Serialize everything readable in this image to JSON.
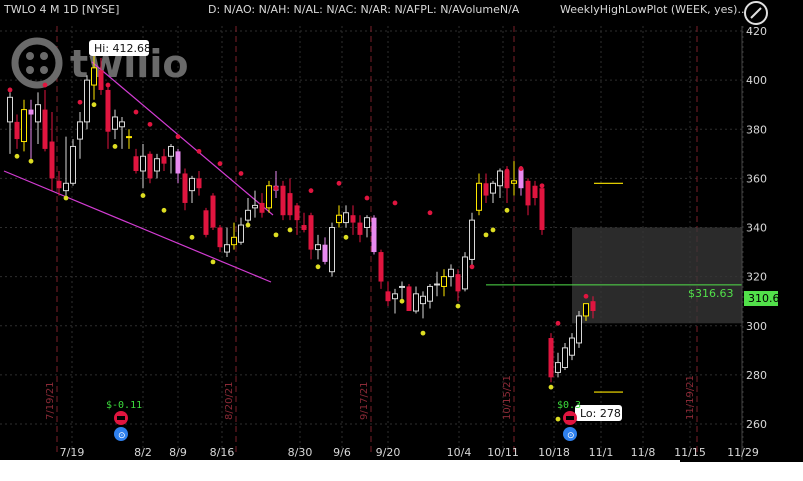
{
  "header": {
    "symbol": "TWLO 4 M 1D [NYSE]",
    "stats": "D: N/AO: N/AH: N/AL: N/AC: N/AR: N/AFPL: N/AVolumeN/A",
    "study": "WeeklyHighLowPlot (WEEK, yes)..."
  },
  "logo": {
    "text": "twilio",
    "color": "#ffffff"
  },
  "colors": {
    "background": "#000000",
    "grid": "#2e2e2e",
    "up": "#d8d8d8",
    "up_alt": "#ffe800",
    "down": "#e0153f",
    "down_alt": "#e88af0",
    "trendline": "#d23cd2",
    "hline": "#52e04a",
    "dot_high": "#e0153f",
    "dot_low": "#dddd22",
    "event_icon_red": "#e0153f",
    "event_icon_blue": "#2f80ed"
  },
  "annotations": {
    "hi_label": "Hi: 412.68",
    "lo_label": "Lo: 278",
    "hline_price_label": "$316.63",
    "last_price_label": "310.6",
    "earnings_left": "$-0.11",
    "earnings_right": "$0.3"
  },
  "vertical_date_labels": [
    "7/19/21",
    "8/20/21",
    "9/17/21",
    "10/15/21",
    "11/19/21"
  ],
  "chart_data": {
    "type": "candlestick",
    "title": "TWLO 4 M 1D [NYSE]",
    "y_ticks": [
      260,
      280,
      300,
      320,
      340,
      360,
      380,
      400,
      420
    ],
    "ylim": [
      250,
      426
    ],
    "x_ticks": [
      "7/19",
      "8/2",
      "8/9",
      "8/16",
      "8/30",
      "9/6",
      "9/20",
      "10/4",
      "10/11",
      "10/18",
      "11/1",
      "11/8",
      "11/15",
      "11/29"
    ],
    "last_price": 310.6,
    "horizontal_level": 316.63,
    "weekly_high_segment": 358,
    "weekly_low_segment": 273,
    "shaded_zone": [
      301,
      340
    ],
    "candles": [
      {
        "o": 383,
        "h": 395,
        "l": 370,
        "c": 393
      },
      {
        "o": 383,
        "h": 386,
        "l": 372,
        "c": 376
      },
      {
        "o": 375,
        "h": 392,
        "l": 371,
        "c": 388
      },
      {
        "o": 388,
        "h": 392,
        "l": 368,
        "c": 386
      },
      {
        "o": 383,
        "h": 395,
        "l": 374,
        "c": 390
      },
      {
        "o": 388,
        "h": 396,
        "l": 371,
        "c": 372
      },
      {
        "o": 375,
        "h": 387,
        "l": 355,
        "c": 360
      },
      {
        "o": 359,
        "h": 363,
        "l": 353,
        "c": 356
      },
      {
        "o": 355,
        "h": 377,
        "l": 353,
        "c": 358
      },
      {
        "o": 358,
        "h": 376,
        "l": 357,
        "c": 373
      },
      {
        "o": 376,
        "h": 387,
        "l": 368,
        "c": 383
      },
      {
        "o": 383,
        "h": 402,
        "l": 380,
        "c": 400
      },
      {
        "o": 398,
        "h": 411,
        "l": 392,
        "c": 405
      },
      {
        "o": 404,
        "h": 409,
        "l": 394,
        "c": 396
      },
      {
        "o": 396,
        "h": 398,
        "l": 372,
        "c": 379
      },
      {
        "o": 380,
        "h": 388,
        "l": 376,
        "c": 385
      },
      {
        "o": 381,
        "h": 385,
        "l": 372,
        "c": 383
      },
      {
        "o": 377,
        "h": 380,
        "l": 372,
        "c": 377
      },
      {
        "o": 369,
        "h": 372,
        "l": 362,
        "c": 363
      },
      {
        "o": 363,
        "h": 374,
        "l": 356,
        "c": 369
      },
      {
        "o": 370,
        "h": 371,
        "l": 358,
        "c": 360
      },
      {
        "o": 363,
        "h": 370,
        "l": 360,
        "c": 368
      },
      {
        "o": 369,
        "h": 372,
        "l": 363,
        "c": 366
      },
      {
        "o": 369,
        "h": 374,
        "l": 362,
        "c": 373
      },
      {
        "o": 371,
        "h": 372,
        "l": 358,
        "c": 362
      },
      {
        "o": 362,
        "h": 364,
        "l": 347,
        "c": 350
      },
      {
        "o": 355,
        "h": 361,
        "l": 350,
        "c": 360
      },
      {
        "o": 360,
        "h": 363,
        "l": 353,
        "c": 356
      },
      {
        "o": 347,
        "h": 348,
        "l": 336,
        "c": 337
      },
      {
        "o": 353,
        "h": 354,
        "l": 339,
        "c": 340
      },
      {
        "o": 340,
        "h": 341,
        "l": 330,
        "c": 332
      },
      {
        "o": 330,
        "h": 340,
        "l": 328,
        "c": 333
      },
      {
        "o": 333,
        "h": 342,
        "l": 331,
        "c": 336
      },
      {
        "o": 334,
        "h": 344,
        "l": 333,
        "c": 341
      },
      {
        "o": 343,
        "h": 352,
        "l": 340,
        "c": 347
      },
      {
        "o": 348,
        "h": 355,
        "l": 344,
        "c": 349
      },
      {
        "o": 350,
        "h": 354,
        "l": 344,
        "c": 346
      },
      {
        "o": 348,
        "h": 359,
        "l": 346,
        "c": 357
      },
      {
        "o": 357,
        "h": 363,
        "l": 352,
        "c": 355
      },
      {
        "o": 357,
        "h": 359,
        "l": 343,
        "c": 345
      },
      {
        "o": 354,
        "h": 360,
        "l": 343,
        "c": 345
      },
      {
        "o": 349,
        "h": 350,
        "l": 337,
        "c": 343
      },
      {
        "o": 341,
        "h": 346,
        "l": 338,
        "c": 339
      },
      {
        "o": 345,
        "h": 346,
        "l": 327,
        "c": 331
      },
      {
        "o": 331,
        "h": 337,
        "l": 327,
        "c": 333
      },
      {
        "o": 333,
        "h": 336,
        "l": 325,
        "c": 326
      },
      {
        "o": 322,
        "h": 342,
        "l": 320,
        "c": 340
      },
      {
        "o": 342,
        "h": 349,
        "l": 340,
        "c": 345
      },
      {
        "o": 342,
        "h": 349,
        "l": 340,
        "c": 346
      },
      {
        "o": 345,
        "h": 349,
        "l": 337,
        "c": 342
      },
      {
        "o": 342,
        "h": 345,
        "l": 334,
        "c": 337
      },
      {
        "o": 340,
        "h": 345,
        "l": 336,
        "c": 344
      },
      {
        "o": 344,
        "h": 345,
        "l": 329,
        "c": 330
      },
      {
        "o": 330,
        "h": 331,
        "l": 315,
        "c": 318
      },
      {
        "o": 314,
        "h": 318,
        "l": 308,
        "c": 310
      },
      {
        "o": 311,
        "h": 315,
        "l": 305,
        "c": 313
      },
      {
        "o": 316,
        "h": 318,
        "l": 311,
        "c": 316
      },
      {
        "o": 316,
        "h": 317,
        "l": 306,
        "c": 306
      },
      {
        "o": 306,
        "h": 316,
        "l": 305,
        "c": 313
      },
      {
        "o": 309,
        "h": 314,
        "l": 303,
        "c": 312
      },
      {
        "o": 310,
        "h": 317,
        "l": 307,
        "c": 316
      },
      {
        "o": 317,
        "h": 322,
        "l": 312,
        "c": 317
      },
      {
        "o": 316,
        "h": 323,
        "l": 312,
        "c": 320
      },
      {
        "o": 320,
        "h": 325,
        "l": 316,
        "c": 323
      },
      {
        "o": 321,
        "h": 323,
        "l": 310,
        "c": 314
      },
      {
        "o": 315,
        "h": 330,
        "l": 314,
        "c": 328
      },
      {
        "o": 327,
        "h": 346,
        "l": 324,
        "c": 343
      },
      {
        "o": 347,
        "h": 362,
        "l": 345,
        "c": 358
      },
      {
        "o": 358,
        "h": 362,
        "l": 350,
        "c": 353
      },
      {
        "o": 354,
        "h": 359,
        "l": 350,
        "c": 358
      },
      {
        "o": 357,
        "h": 364,
        "l": 352,
        "c": 363
      },
      {
        "o": 363,
        "h": 365,
        "l": 350,
        "c": 356
      },
      {
        "o": 358,
        "h": 367,
        "l": 353,
        "c": 359
      },
      {
        "o": 364,
        "h": 365,
        "l": 353,
        "c": 356
      },
      {
        "o": 359,
        "h": 360,
        "l": 345,
        "c": 349
      },
      {
        "o": 357,
        "h": 359,
        "l": 349,
        "c": 352
      },
      {
        "o": 356,
        "h": 357,
        "l": 337,
        "c": 339
      },
      {
        "o": 295,
        "h": 297,
        "l": 277,
        "c": 279
      },
      {
        "o": 281,
        "h": 289,
        "l": 279,
        "c": 285
      },
      {
        "o": 283,
        "h": 293,
        "l": 282,
        "c": 291
      },
      {
        "o": 288,
        "h": 297,
        "l": 286,
        "c": 295
      },
      {
        "o": 293,
        "h": 306,
        "l": 291,
        "c": 304
      },
      {
        "o": 304,
        "h": 309,
        "l": 302,
        "c": 309
      },
      {
        "o": 310,
        "h": 312,
        "l": 303,
        "c": 306
      }
    ],
    "high_dots": [
      [
        0,
        396
      ],
      [
        5,
        398
      ],
      [
        10,
        391
      ],
      [
        14,
        398
      ],
      [
        18,
        387
      ],
      [
        20,
        382
      ],
      [
        24,
        377
      ],
      [
        27,
        371
      ],
      [
        30,
        366
      ],
      [
        33,
        362
      ],
      [
        38,
        356
      ],
      [
        43,
        355
      ],
      [
        47,
        358
      ],
      [
        51,
        352
      ],
      [
        55,
        350
      ],
      [
        60,
        346
      ],
      [
        66,
        324
      ],
      [
        71,
        363
      ],
      [
        73,
        364
      ],
      [
        76,
        357
      ],
      [
        78,
        301
      ],
      [
        82,
        312
      ]
    ],
    "low_dots": [
      [
        1,
        369
      ],
      [
        3,
        367
      ],
      [
        8,
        352
      ],
      [
        12,
        390
      ],
      [
        15,
        373
      ],
      [
        19,
        353
      ],
      [
        22,
        347
      ],
      [
        26,
        336
      ],
      [
        29,
        326
      ],
      [
        34,
        341
      ],
      [
        38,
        337
      ],
      [
        40,
        339
      ],
      [
        44,
        324
      ],
      [
        48,
        336
      ],
      [
        56,
        310
      ],
      [
        59,
        297
      ],
      [
        64,
        308
      ],
      [
        68,
        337
      ],
      [
        69,
        339
      ],
      [
        71,
        347
      ],
      [
        77,
        275
      ],
      [
        78,
        262
      ]
    ]
  }
}
